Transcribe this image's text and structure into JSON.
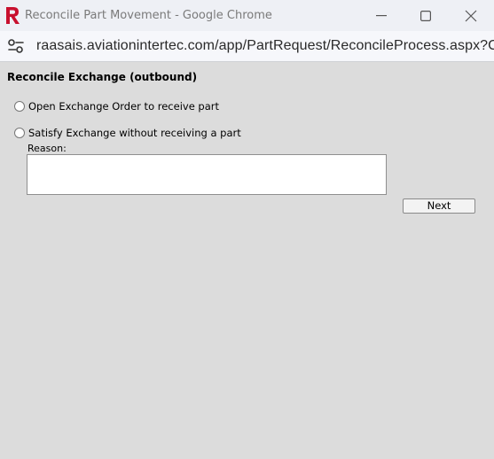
{
  "window": {
    "title": "Reconcile Part Movement - Google Chrome",
    "url": "raasais.aviationintertec.com/app/PartRequest/ReconcileProcess.aspx?C...",
    "minimize_icon": "minimize-icon",
    "maximize_icon": "maximize-icon",
    "close_icon": "close-icon",
    "site_info_icon": "tune-icon",
    "app_logo": "R"
  },
  "form": {
    "title": "Reconcile Exchange (outbound)",
    "options": [
      {
        "label": "Open Exchange Order to receive part",
        "selected": false
      },
      {
        "label": "Satisfy Exchange without receiving a part",
        "selected": false
      }
    ],
    "reason_label": "Reason:",
    "reason_value": "",
    "next_label": "Next"
  },
  "colors": {
    "background": "#dcdcdc",
    "logo_red": "#c8102e"
  }
}
